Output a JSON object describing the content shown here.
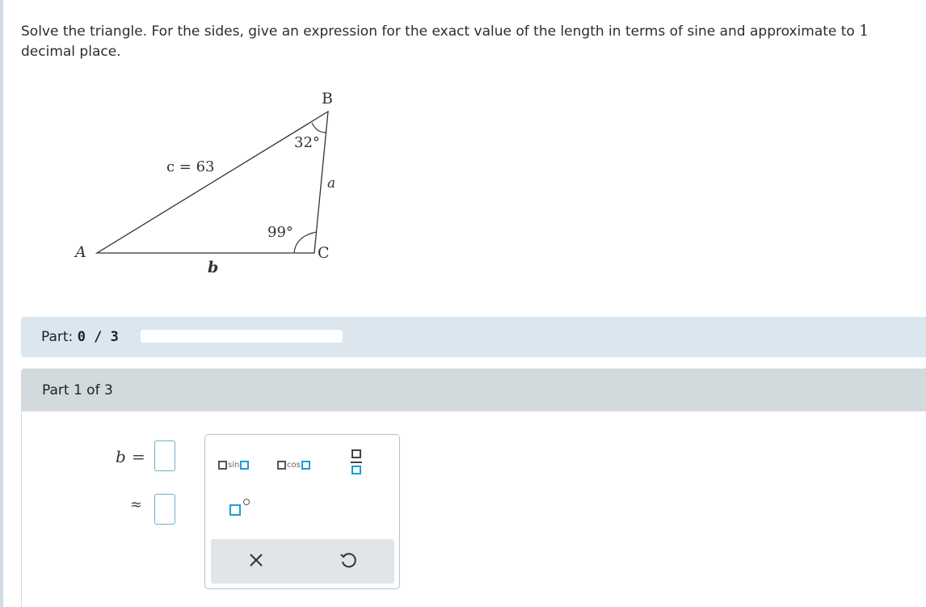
{
  "problem": {
    "text": "Solve the triangle. For the sides, give an expression for the exact value of the length in terms of sine and approximate to",
    "number": "1",
    "text_end": "decimal place."
  },
  "figure": {
    "vertex_a": "A",
    "vertex_b": "B",
    "vertex_c": "C",
    "side_c": "c = 63",
    "side_a": "a",
    "side_b": "b",
    "angle_b": "32°",
    "angle_c": "99°"
  },
  "part_bar": {
    "label_prefix": "Part:",
    "progress_text": "0 / 3",
    "progress_fraction": 0
  },
  "part_header": {
    "title": "Part 1 of 3"
  },
  "answer": {
    "variable": "b",
    "equals": "=",
    "approx": "≈"
  },
  "palette": {
    "sin_label": "sin",
    "cos_label": "cos",
    "fraction_tool": "fraction-icon",
    "degree_tool": "degree-icon",
    "clear_icon": "close-icon",
    "undo_icon": "undo-icon"
  },
  "colors": {
    "part_bar_bg": "#dce6ef",
    "part_header_bg": "#d3dadd",
    "accent_blue": "#1f9bd7",
    "input_border": "#6fb1c8"
  }
}
